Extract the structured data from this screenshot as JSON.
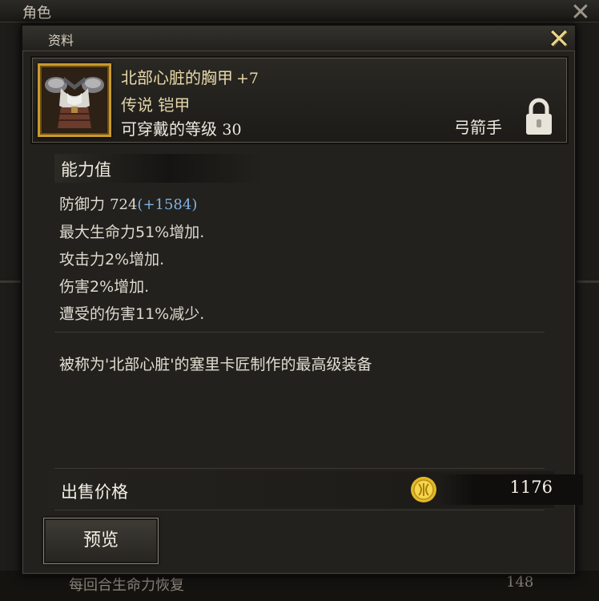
{
  "background_window": {
    "title": "角色",
    "close_glyph": "✕",
    "footer": {
      "label": "每回合生命力恢复",
      "value": "148"
    }
  },
  "panel": {
    "title": "资料",
    "close_glyph": "✕"
  },
  "item": {
    "name": "北部心脏的胸甲",
    "enhance": "+7",
    "grade": "传说 铠甲",
    "level_label": "可穿戴的等级",
    "level_value": "30",
    "class": "弓箭手",
    "icon": "chest-armor-icon",
    "lock_icon": "lock-icon"
  },
  "stats": {
    "heading": "能力值",
    "defense_label": "防御力",
    "defense_value": "724",
    "defense_bonus": "(+1584)",
    "lines": [
      "最大生命力51%增加.",
      "攻击力2%增加.",
      "伤害2%增加.",
      "遭受的伤害11%减少."
    ]
  },
  "description": "被称为'北部心脏'的塞里卡匠制作的最高级装备",
  "sell": {
    "label": "出售价格",
    "value": "1176",
    "icon": "gold-coin-icon"
  },
  "preview_button": {
    "label": "预览"
  },
  "colors": {
    "accent_gold": "#c99a2c",
    "bonus_blue": "#7fb4e4",
    "close_gold": "#e9d58a"
  }
}
